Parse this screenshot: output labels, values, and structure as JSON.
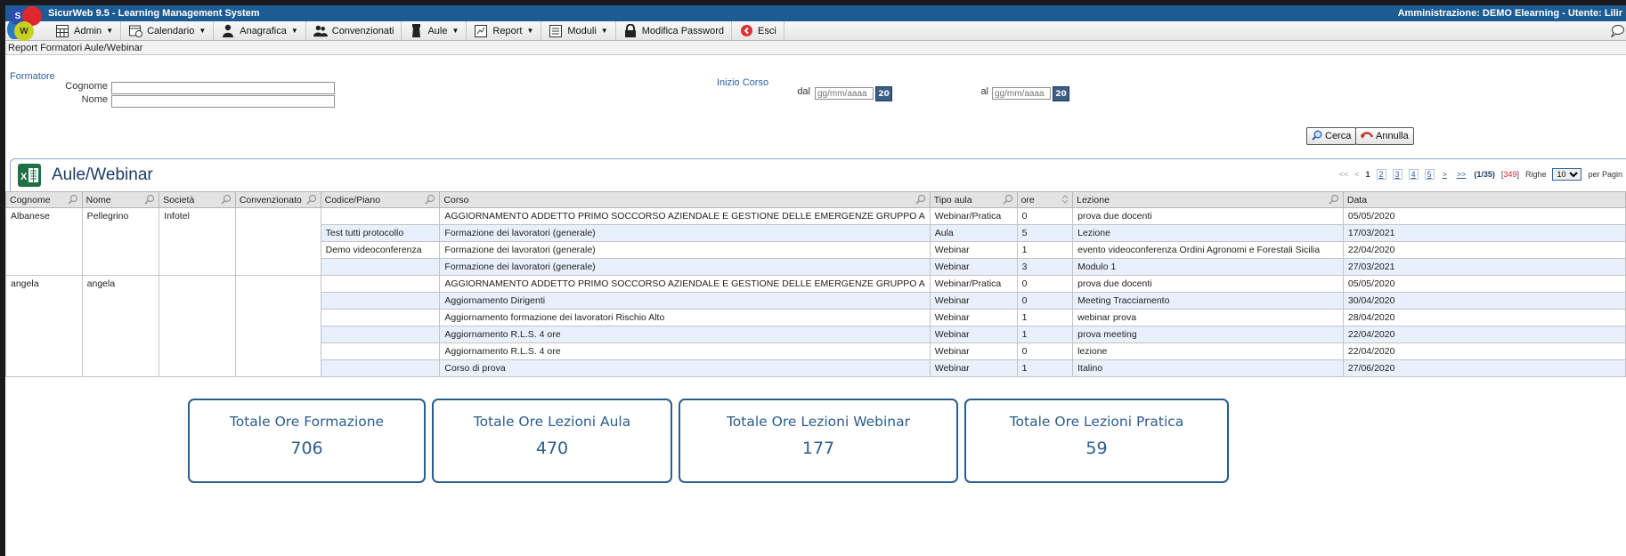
{
  "app": {
    "title": "SicurWeb 9.5 - Learning Management System",
    "user_info": "Amministrazione: DEMO Elearning - Utente: Lilir"
  },
  "menu": [
    {
      "label": "Admin",
      "icon": "admin-grid-icon",
      "dropdown": true
    },
    {
      "label": "Calendario",
      "icon": "calendar-icon",
      "dropdown": true
    },
    {
      "label": "Anagrafica",
      "icon": "user-icon",
      "dropdown": true
    },
    {
      "label": "Convenzionati",
      "icon": "users-icon",
      "dropdown": false
    },
    {
      "label": "Aule",
      "icon": "classroom-icon",
      "dropdown": true
    },
    {
      "label": "Report",
      "icon": "report-icon",
      "dropdown": true
    },
    {
      "label": "Moduli",
      "icon": "modules-icon",
      "dropdown": true
    },
    {
      "label": "Modifica Password",
      "icon": "lock-icon",
      "dropdown": false
    },
    {
      "label": "Esci",
      "icon": "exit-icon",
      "dropdown": false
    }
  ],
  "breadcrumb": "Report Formatori Aule/Webinar",
  "filters": {
    "formatore_label": "Formatore",
    "cognome_label": "Cognome",
    "nome_label": "Nome",
    "cognome_value": "",
    "nome_value": "",
    "inizio_label": "Inizio Corso",
    "dal_label": "dal",
    "al_label": "al",
    "date_placeholder": "gg/mm/aaaa",
    "cal_badge": "20",
    "search_button": "Cerca",
    "cancel_button": "Annulla"
  },
  "section": {
    "title": "Aule/Webinar"
  },
  "pager": {
    "first": "<<",
    "prev": "<",
    "current": "1",
    "pages": [
      "2",
      "3",
      "4",
      "5"
    ],
    "next": ">",
    "last": ">>",
    "page_info": "(1/35)",
    "total_open": "[",
    "total": "349",
    "total_close": "]",
    "rows_label": "Righe",
    "rows_value": "10",
    "per_page_label": "per Pagin"
  },
  "table": {
    "columns": [
      "Cognome",
      "Nome",
      "Società",
      "Convenzionato",
      "Codice/Piano",
      "Corso",
      "Tipo aula",
      "ore",
      "Lezione",
      "Data"
    ],
    "groups": [
      {
        "cognome": "Albanese",
        "nome": "Pellegrino",
        "societa": "Infotel",
        "convenzionato": "",
        "rows": [
          {
            "codice": "",
            "corso": "AGGIORNAMENTO ADDETTO PRIMO SOCCORSO AZIENDALE E GESTIONE DELLE EMERGENZE GRUPPO A",
            "tipo": "Webinar/Pratica",
            "ore": "0",
            "lezione": "prova due docenti",
            "data": "05/05/2020"
          },
          {
            "codice": "Test tutti protocollo",
            "corso": "Formazione dei lavoratori (generale)",
            "tipo": "Aula",
            "ore": "5",
            "lezione": "Lezione",
            "data": "17/03/2021"
          },
          {
            "codice": "Demo videoconferenza",
            "corso": "Formazione dei lavoratori (generale)",
            "tipo": "Webinar",
            "ore": "1",
            "lezione": "evento videoconferenza Ordini Agronomi e Forestali Sicilia",
            "data": "22/04/2020"
          },
          {
            "codice": "",
            "corso": "Formazione dei lavoratori (generale)",
            "tipo": "Webinar",
            "ore": "3",
            "lezione": "Modulo 1",
            "data": "27/03/2021"
          }
        ]
      },
      {
        "cognome": "angela",
        "nome": "angela",
        "societa": "",
        "convenzionato": "",
        "rows": [
          {
            "codice": "",
            "corso": "AGGIORNAMENTO ADDETTO PRIMO SOCCORSO AZIENDALE E GESTIONE DELLE EMERGENZE GRUPPO A",
            "tipo": "Webinar/Pratica",
            "ore": "0",
            "lezione": "prova due docenti",
            "data": "05/05/2020"
          },
          {
            "codice": "",
            "corso": "Aggiornamento Dirigenti",
            "tipo": "Webinar",
            "ore": "0",
            "lezione": "Meeting Tracciamento",
            "data": "30/04/2020"
          },
          {
            "codice": "",
            "corso": "Aggiornamento formazione dei lavoratori Rischio Alto",
            "tipo": "Webinar",
            "ore": "1",
            "lezione": "webinar prova",
            "data": "28/04/2020"
          },
          {
            "codice": "",
            "corso": "Aggiornamento R.L.S. 4 ore",
            "tipo": "Webinar",
            "ore": "1",
            "lezione": "prova meeting",
            "data": "22/04/2020"
          },
          {
            "codice": "",
            "corso": "Aggiornamento R.L.S. 4 ore",
            "tipo": "Webinar",
            "ore": "0",
            "lezione": "lezione",
            "data": "22/04/2020"
          },
          {
            "codice": "",
            "corso": "Corso di prova",
            "tipo": "Webinar",
            "ore": "1",
            "lezione": "Italino",
            "data": "27/06/2020"
          }
        ]
      }
    ]
  },
  "totals": [
    {
      "label": "Totale Ore Formazione",
      "value": "706"
    },
    {
      "label": "Totale Ore Lezioni Aula",
      "value": "470"
    },
    {
      "label": "Totale Ore Lezioni Webinar",
      "value": "177"
    },
    {
      "label": "Totale Ore Lezioni Pratica",
      "value": "59"
    }
  ],
  "colors": {
    "titlebar": "#1d5b93",
    "accent": "#2b5d8c",
    "row_alt": "#e8f0fb"
  }
}
